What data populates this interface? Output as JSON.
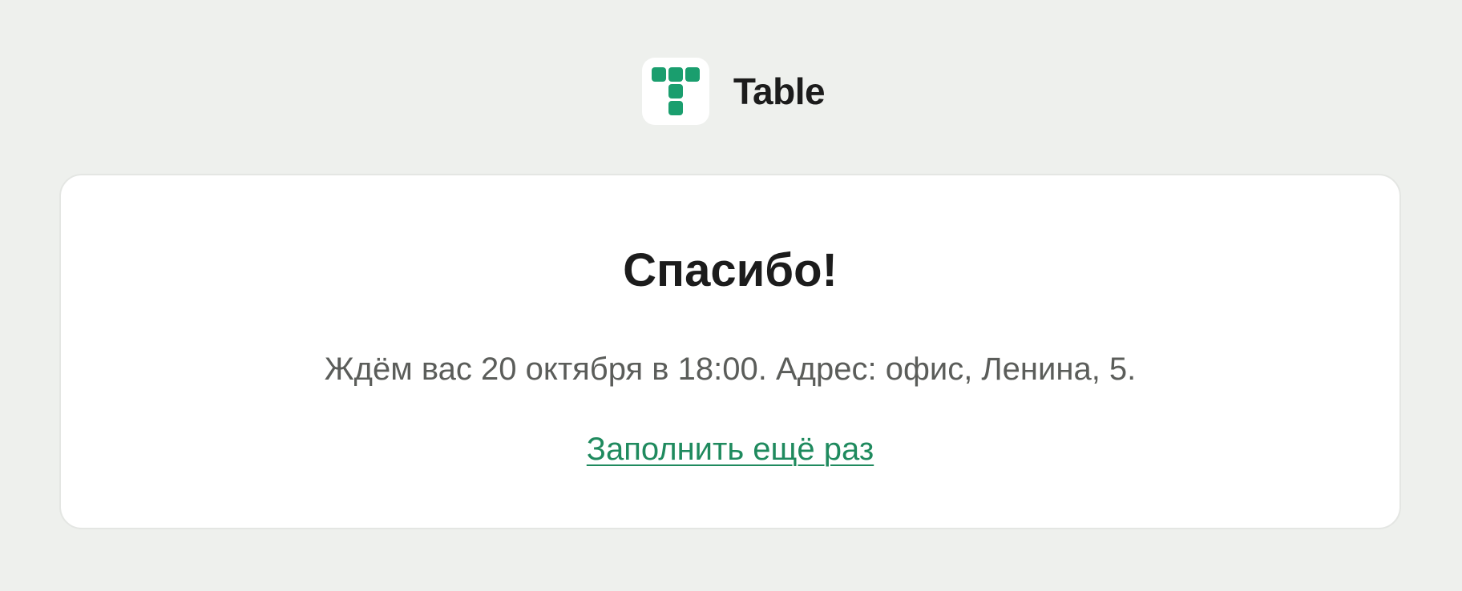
{
  "brand": {
    "name": "Table",
    "icon": "table-logo-icon",
    "accent_color": "#1a9e6e"
  },
  "card": {
    "title": "Спасибо!",
    "message": "Ждём вас 20 октября в 18:00. Адрес: офис, Ленина, 5.",
    "link_label": "Заполнить ещё раз",
    "link_color": "#1f8a5e"
  }
}
